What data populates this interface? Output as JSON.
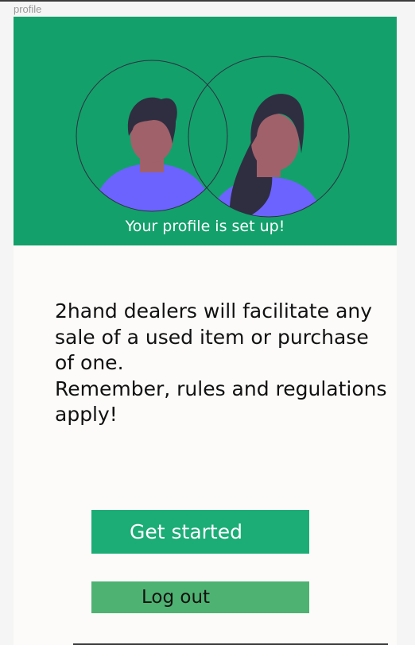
{
  "window": {
    "frame_label": "profile"
  },
  "hero": {
    "caption": "Your profile is set up!",
    "illustration": {
      "description_icon": "two-avatars-illustration",
      "colors": {
        "background": "#13a06b",
        "hair": "#2f2e41",
        "skin": "#a0616a",
        "shirt": "#6c63ff",
        "circle_outline": "#2f2e41"
      }
    }
  },
  "main": {
    "paragraphs": [
      "2hand dealers will facilitate any sale of a used item or purchase of one.",
      "Remember, rules and regulations apply!"
    ]
  },
  "actions": {
    "get_started_label": "Get started",
    "log_out_label": "Log out"
  },
  "colors": {
    "get_started_bg": "#1cad76",
    "log_out_bg": "#4eb272",
    "page_bg": "#fcfbf9"
  }
}
